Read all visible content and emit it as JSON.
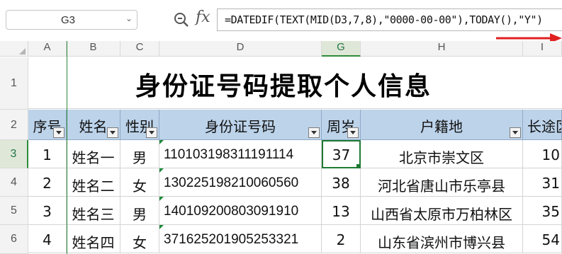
{
  "formula_bar": {
    "name_box": "G3",
    "formula": "=DATEDIF(TEXT(MID(D3,7,8),\"0000-00-00\"),TODAY(),\"Y\")"
  },
  "columns": [
    "A",
    "B",
    "C",
    "D",
    "G",
    "H",
    "I"
  ],
  "rows": [
    "1",
    "2",
    "3",
    "4",
    "5",
    "6"
  ],
  "title": "身份证号码提取个人信息",
  "headers": [
    "序号",
    "姓名",
    "性别",
    "身份证号码",
    "周岁",
    "户籍地",
    "长途区"
  ],
  "data": [
    [
      "1",
      "姓名一",
      "男",
      "110103198311191114",
      "37",
      "北京市崇文区",
      "10"
    ],
    [
      "2",
      "姓名二",
      "女",
      "130225198210060560",
      "38",
      "河北省唐山市乐亭县",
      "31"
    ],
    [
      "3",
      "姓名三",
      "男",
      "140109200803091910",
      "13",
      "山西省太原市万柏林区",
      "35"
    ],
    [
      "4",
      "姓名四",
      "女",
      "371625201905253321",
      "2",
      "山东省滨州市博兴县",
      "54"
    ]
  ],
  "colors": {
    "header_fill": "#bcd3ea",
    "selection_green": "#2e8b3a",
    "annotation_arrow": "#e02020"
  },
  "icons": {
    "zoom": "magnifier-icon",
    "function": "fx-icon",
    "dropdown": "chevron-down-icon",
    "filter": "filter-dropdown-icon"
  }
}
